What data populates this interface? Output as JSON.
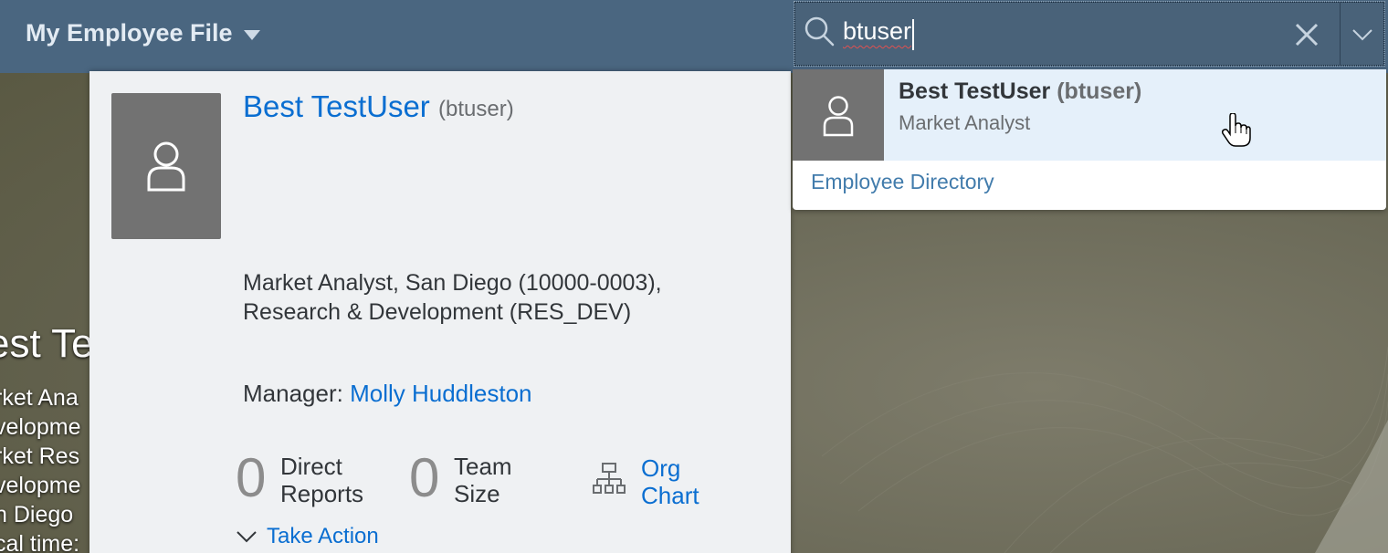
{
  "header": {
    "app_title": "My Employee File"
  },
  "search": {
    "query": "btuser",
    "placeholder": ""
  },
  "background_profile": {
    "name": "est Te",
    "lines": [
      "rket Ana",
      "velopme",
      "rket Res",
      "velopme",
      "n Diego",
      "cal time:"
    ]
  },
  "quickcard": {
    "name": "Best TestUser",
    "user_id": "(btuser)",
    "job_info": "Market Analyst, San Diego (10000-0003), Research & Development (RES_DEV)",
    "manager_label": "Manager:",
    "manager_name": "Molly Huddleston",
    "direct_reports_count": "0",
    "direct_reports_label": "Direct Reports",
    "team_size_count": "0",
    "team_size_label": "Team Size",
    "org_chart_label": "Org Chart",
    "take_action_label": "Take Action"
  },
  "suggestions": {
    "items": [
      {
        "name": "Best TestUser",
        "user_id": "(btuser)",
        "title": "Market Analyst"
      }
    ],
    "directory_link": "Employee Directory"
  },
  "colors": {
    "shell": "#4a6680",
    "link": "#0a6ed1",
    "highlight": "#e5f0fa"
  }
}
